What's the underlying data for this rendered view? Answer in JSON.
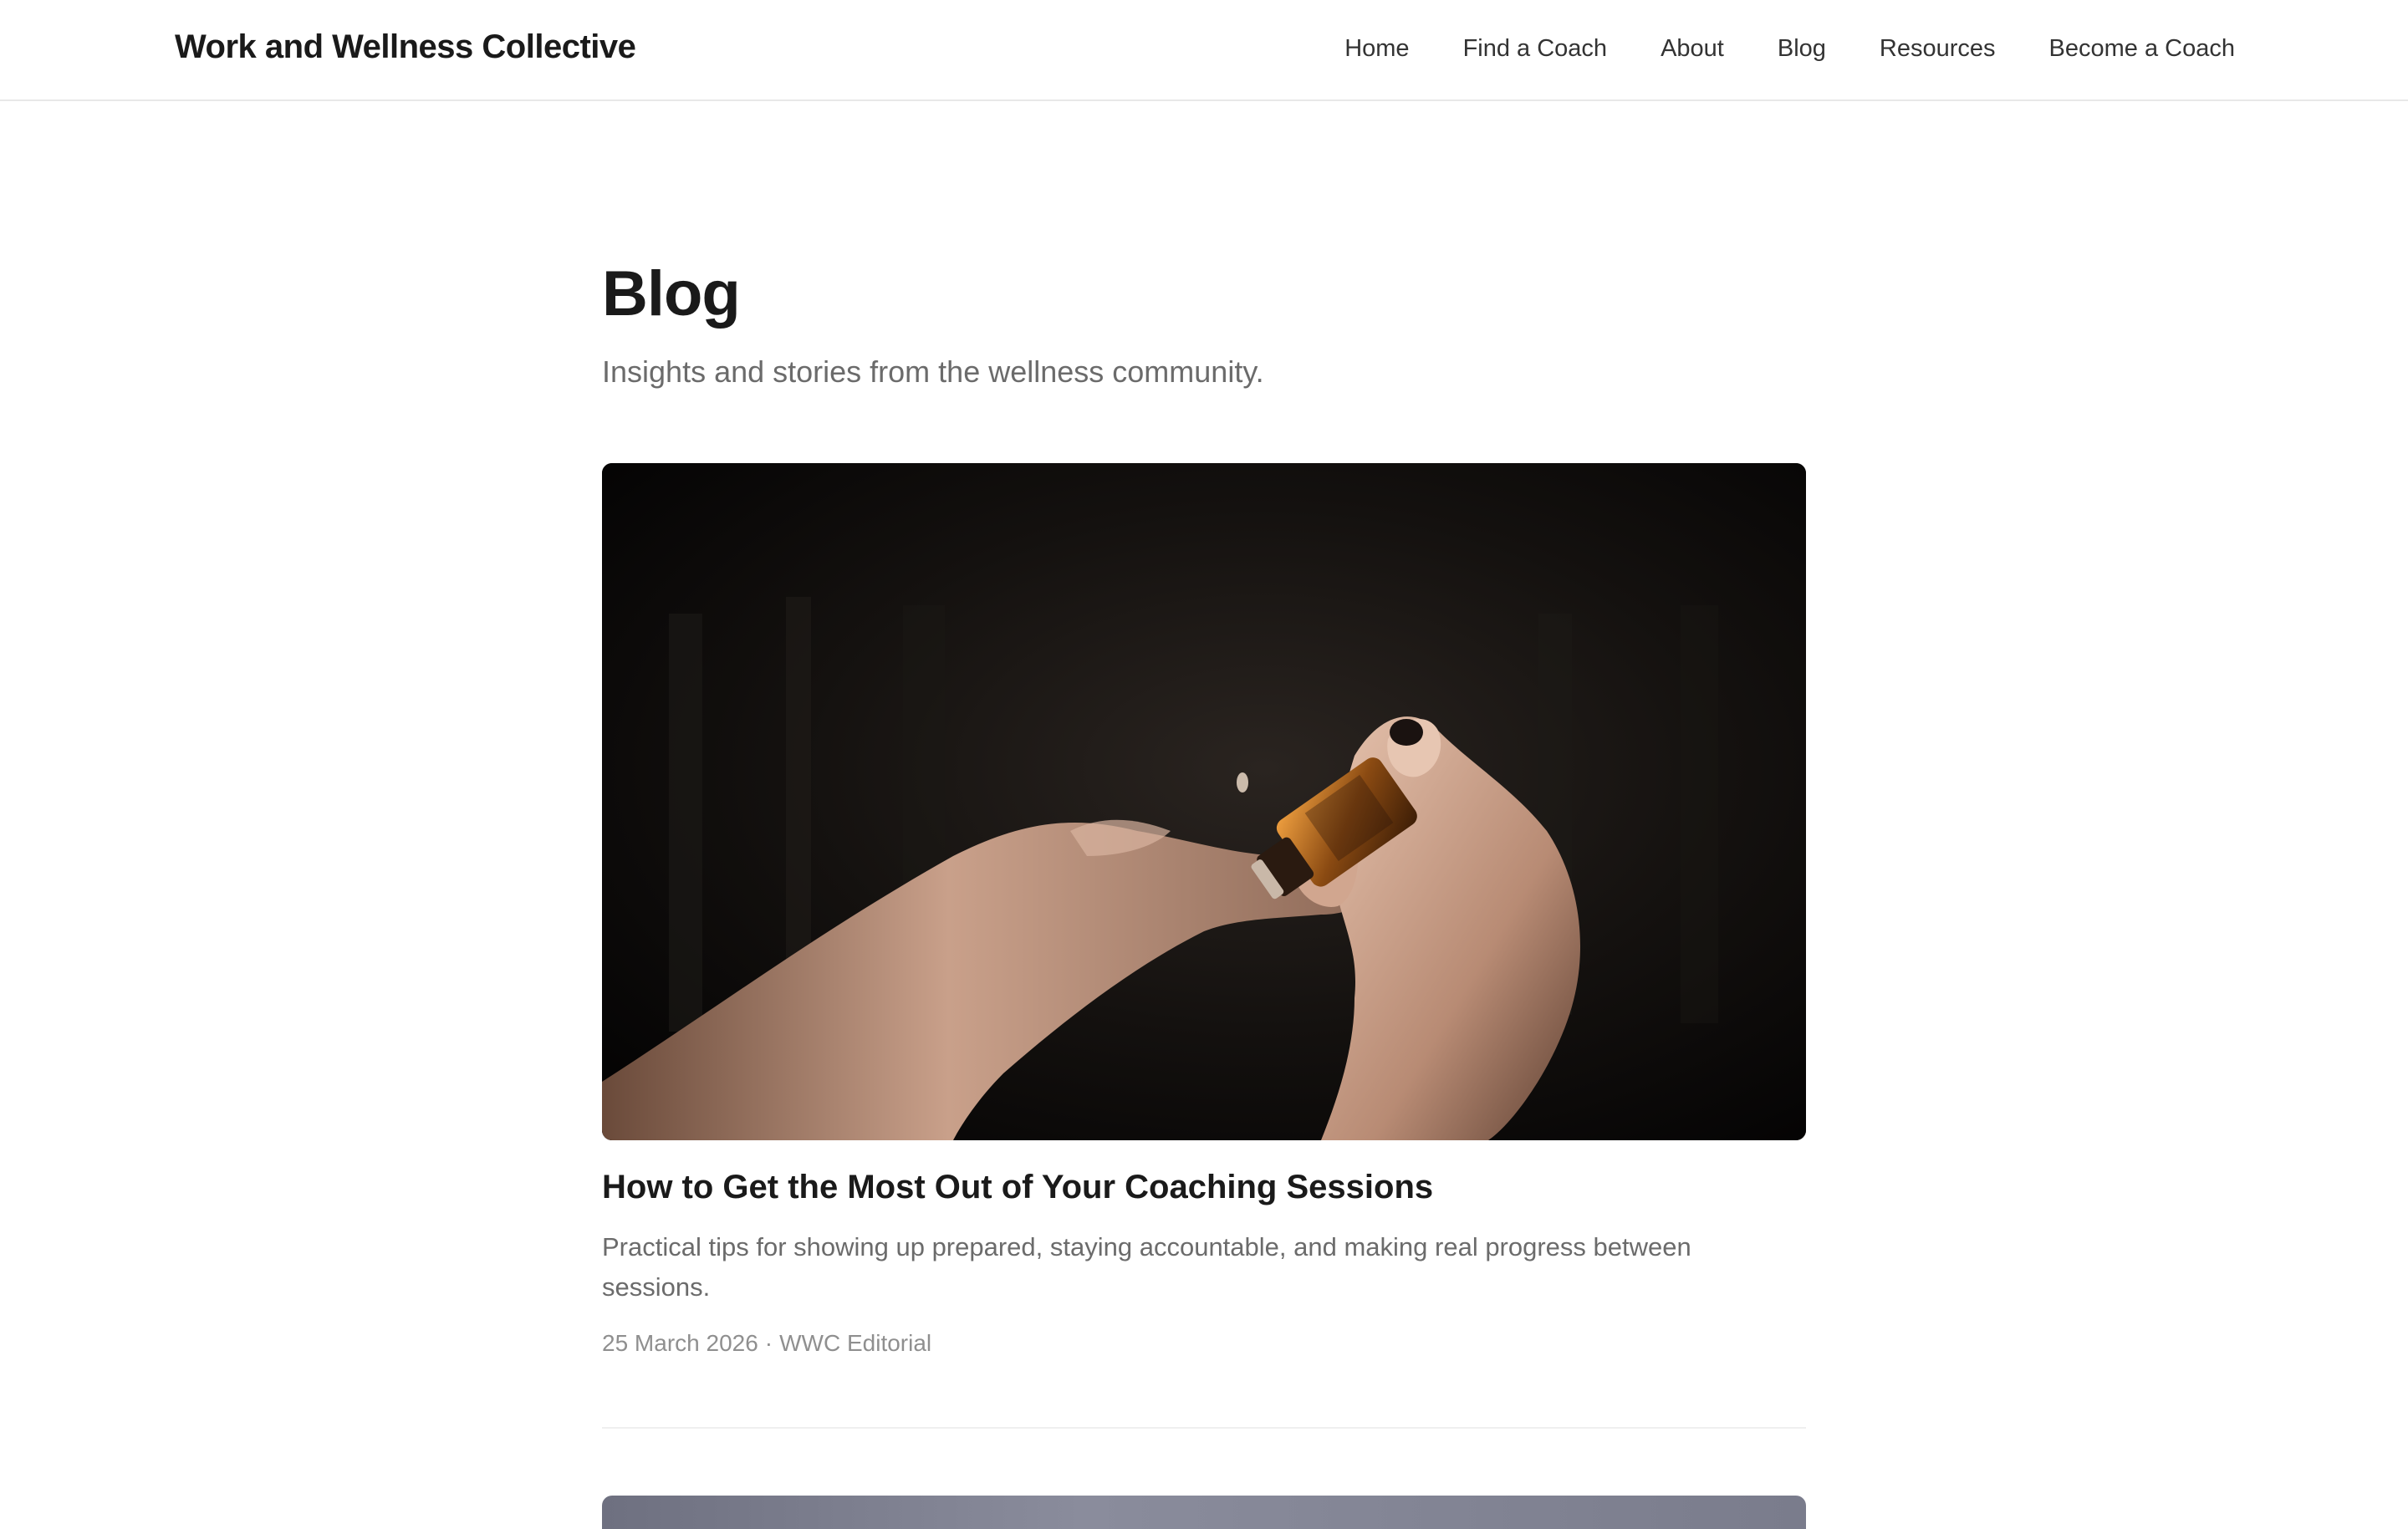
{
  "header": {
    "brand": "Work and Wellness Collective",
    "nav": [
      {
        "label": "Home"
      },
      {
        "label": "Find a Coach"
      },
      {
        "label": "About"
      },
      {
        "label": "Blog"
      },
      {
        "label": "Resources"
      },
      {
        "label": "Become a Coach"
      }
    ]
  },
  "page": {
    "title": "Blog",
    "subtitle": "Insights and stories from the wellness community."
  },
  "posts": [
    {
      "title": "How to Get the Most Out of Your Coaching Sessions",
      "excerpt": "Practical tips for showing up prepared, staying accountable, and making real progress between sessions.",
      "date": "25 March 2026",
      "author": "WWC Editorial",
      "image": "photo of hands applying essential oil drop from amber bottle"
    }
  ]
}
